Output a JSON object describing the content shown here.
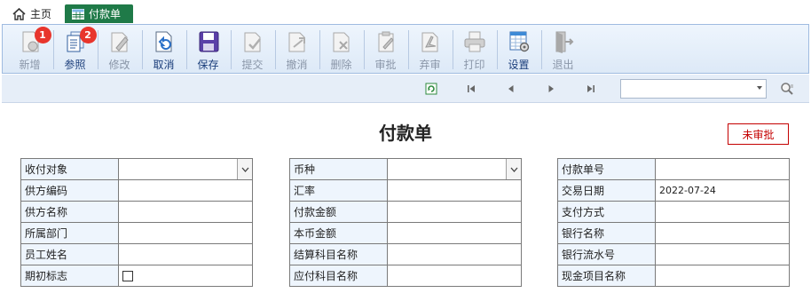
{
  "tabs": {
    "home_label": "主页",
    "active_label": "付款单"
  },
  "toolbar": {
    "items": [
      {
        "label": "新增",
        "enabled": false,
        "badge": "1"
      },
      {
        "label": "参照",
        "enabled": true,
        "badge": "2"
      },
      {
        "label": "修改",
        "enabled": false
      },
      {
        "label": "取消",
        "enabled": true
      },
      {
        "label": "保存",
        "enabled": true
      },
      {
        "label": "提交",
        "enabled": false
      },
      {
        "label": "撤消",
        "enabled": false
      },
      {
        "label": "删除",
        "enabled": false
      },
      {
        "label": "审批",
        "enabled": false
      },
      {
        "label": "弃审",
        "enabled": false
      },
      {
        "label": "打印",
        "enabled": false
      },
      {
        "label": "设置",
        "enabled": true
      },
      {
        "label": "退出",
        "enabled": false
      }
    ]
  },
  "form": {
    "title": "付款单",
    "status": "未审批",
    "left": [
      {
        "label": "收付对象",
        "value": ""
      },
      {
        "label": "供方编码",
        "value": ""
      },
      {
        "label": "供方名称",
        "value": ""
      },
      {
        "label": "所属部门",
        "value": ""
      },
      {
        "label": "员工姓名",
        "value": ""
      },
      {
        "label": "期初标志",
        "value": ""
      }
    ],
    "middle": [
      {
        "label": "币种",
        "value": ""
      },
      {
        "label": "汇率",
        "value": ""
      },
      {
        "label": "付款金额",
        "value": ""
      },
      {
        "label": "本币金额",
        "value": ""
      },
      {
        "label": "结算科目名称",
        "value": ""
      },
      {
        "label": "应付科目名称",
        "value": ""
      }
    ],
    "right": [
      {
        "label": "付款单号",
        "value": ""
      },
      {
        "label": "交易日期",
        "value": "2022-07-24"
      },
      {
        "label": "支付方式",
        "value": ""
      },
      {
        "label": "银行名称",
        "value": ""
      },
      {
        "label": "银行流水号",
        "value": ""
      },
      {
        "label": "现金项目名称",
        "value": ""
      }
    ]
  }
}
